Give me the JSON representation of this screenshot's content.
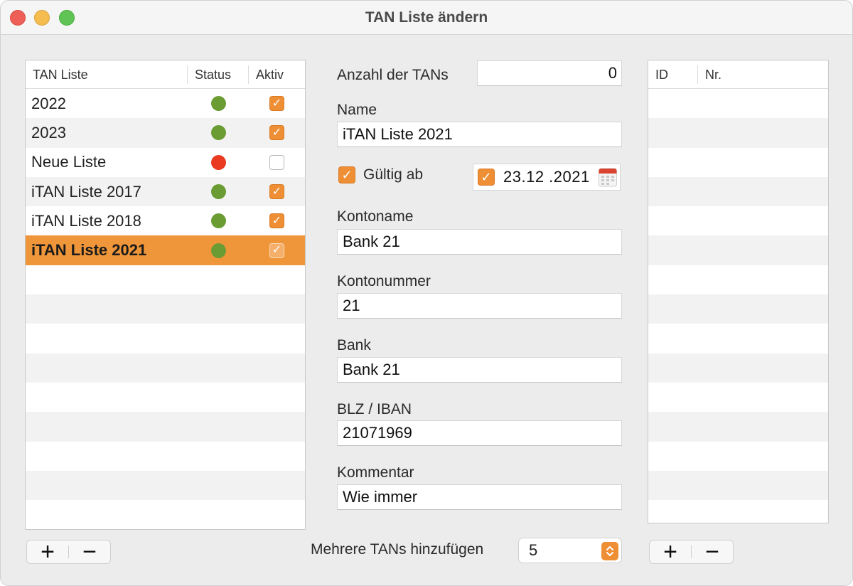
{
  "window": {
    "title": "TAN Liste ändern"
  },
  "left_table": {
    "headers": [
      "TAN Liste",
      "Status",
      "Aktiv"
    ],
    "rows": [
      {
        "name": "2022",
        "status": "green",
        "aktiv": true
      },
      {
        "name": "2023",
        "status": "green",
        "aktiv": true
      },
      {
        "name": "Neue Liste",
        "status": "red",
        "aktiv": false
      },
      {
        "name": "iTAN Liste 2017",
        "status": "green",
        "aktiv": true
      },
      {
        "name": "iTAN Liste 2018",
        "status": "green",
        "aktiv": true
      },
      {
        "name": "iTAN Liste 2021",
        "status": "green",
        "aktiv": true,
        "selected": true
      }
    ],
    "add_label": "+",
    "remove_label": "−"
  },
  "form": {
    "anzahl_label": "Anzahl der TANs",
    "anzahl_value": "0",
    "name_label": "Name",
    "name_value": "iTAN Liste 2021",
    "gueltig_label": "Gültig ab",
    "gueltig_checked": true,
    "date_checked": true,
    "date_value": "23.12 .2021",
    "kontoname_label": "Kontoname",
    "kontoname_value": "Bank 21",
    "kontonummer_label": "Kontonummer",
    "kontonummer_value": "21",
    "bank_label": "Bank",
    "bank_value": "Bank 21",
    "blz_label": "BLZ / IBAN",
    "blz_value": "21071969",
    "kommentar_label": "Kommentar",
    "kommentar_value": "Wie immer",
    "mehrere_label": "Mehrere TANs hinzufügen",
    "mehrere_value": "5"
  },
  "right_table": {
    "headers": [
      "ID",
      "Nr."
    ],
    "add_label": "+",
    "remove_label": "−"
  },
  "colors": {
    "accent": "#ef8f35",
    "status_green": "#6a9c33",
    "status_red": "#ea3b21"
  }
}
